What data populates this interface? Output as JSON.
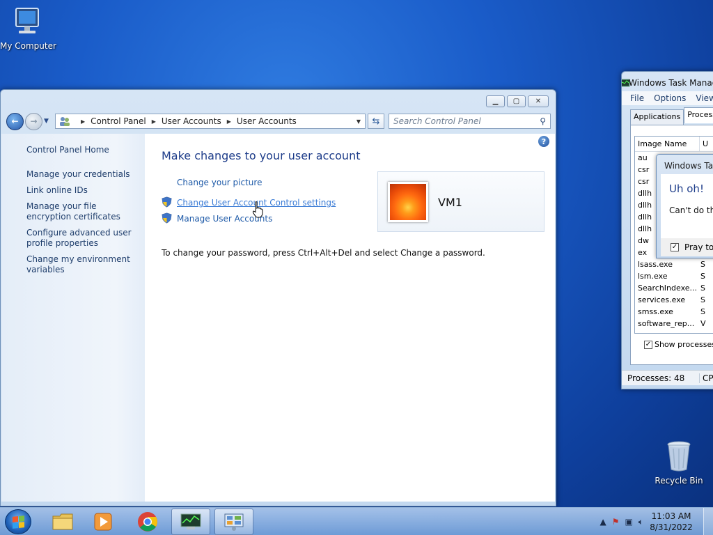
{
  "desktop": {
    "my_computer": "My Computer",
    "recycle_bin": "Recycle Bin"
  },
  "control_panel": {
    "breadcrumbs": [
      "Control Panel",
      "User Accounts",
      "User Accounts"
    ],
    "search_placeholder": "Search Control Panel",
    "sidebar": [
      "Control Panel Home",
      "Manage your credentials",
      "Link online IDs",
      "Manage your file encryption certificates",
      "Configure advanced user profile properties",
      "Change my environment variables"
    ],
    "title": "Make changes to your user account",
    "links": {
      "picture": "Change your picture",
      "uac": "Change User Account Control settings",
      "manage": "Manage User Accounts"
    },
    "password_note": "To change your password, press Ctrl+Alt+Del and select Change a password.",
    "user_name": "VM1"
  },
  "task_manager": {
    "title": "Windows Task Manager",
    "menu": [
      "File",
      "Options",
      "View"
    ],
    "tabs": [
      "Applications",
      "Processes"
    ],
    "columns": [
      "Image Name",
      "U"
    ],
    "rows": [
      [
        "au",
        ""
      ],
      [
        "csr",
        ""
      ],
      [
        "csr",
        ""
      ],
      [
        "dllh",
        ""
      ],
      [
        "dllh",
        ""
      ],
      [
        "dllh",
        ""
      ],
      [
        "dllh",
        ""
      ],
      [
        "dw",
        ""
      ],
      [
        "ex",
        ""
      ],
      [
        "lsass.exe",
        "S"
      ],
      [
        "lsm.exe",
        "S"
      ],
      [
        "SearchIndexe...",
        "S"
      ],
      [
        "services.exe",
        "S"
      ],
      [
        "smss.exe",
        "S"
      ],
      [
        "software_rep...",
        "V"
      ]
    ],
    "show_processes": "Show processes f",
    "status_processes": "Processes: 48",
    "status_cpu": "CP"
  },
  "error_dialog": {
    "title": "Windows Tas",
    "heading": "Uh oh!",
    "message": "Can't do tha",
    "checkbox_label": "Pray to"
  },
  "taskbar": {
    "time": "11:03 AM",
    "date": "8/31/2022"
  }
}
